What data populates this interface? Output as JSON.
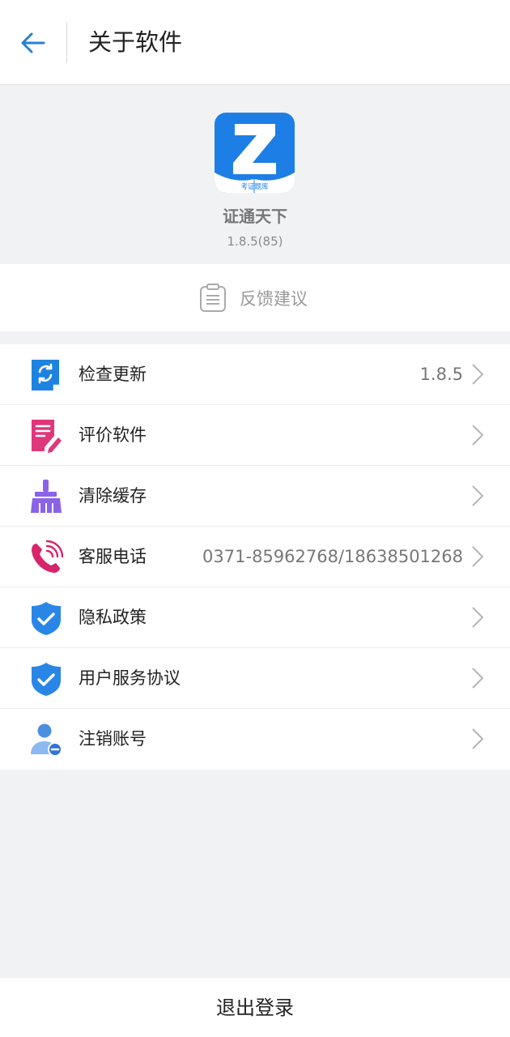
{
  "header": {
    "title": "关于软件",
    "back_icon": "arrow-left-icon",
    "accent_color": "#2a7fd4"
  },
  "app": {
    "logo_letter": "Z",
    "logo_caption": "考证题库",
    "name": "证通天下",
    "version": "1.8.5(85)",
    "logo_color": "#1d7fe6"
  },
  "feedback": {
    "icon": "clipboard-icon",
    "label": "反馈建议"
  },
  "menu": {
    "items": [
      {
        "icon": "refresh-document-icon",
        "label": "检查更新",
        "value": "1.8.5",
        "icon_color": "#1e82e0"
      },
      {
        "icon": "edit-document-icon",
        "label": "评价软件",
        "value": "",
        "icon_color": "#e0367a"
      },
      {
        "icon": "broom-icon",
        "label": "清除缓存",
        "value": "",
        "icon_color": "#8a63e8"
      },
      {
        "icon": "phone-call-icon",
        "label": "客服电话",
        "value": "0371-85962768/18638501268",
        "icon_color": "#d8246a"
      },
      {
        "icon": "shield-check-icon",
        "label": "隐私政策",
        "value": "",
        "icon_color": "#2a86e6"
      },
      {
        "icon": "shield-check-icon",
        "label": "用户服务协议",
        "value": "",
        "icon_color": "#2a86e6"
      },
      {
        "icon": "user-remove-icon",
        "label": "注销账号",
        "value": "",
        "icon_color": "#4a8fe0"
      }
    ]
  },
  "footer": {
    "logout_label": "退出登录"
  }
}
